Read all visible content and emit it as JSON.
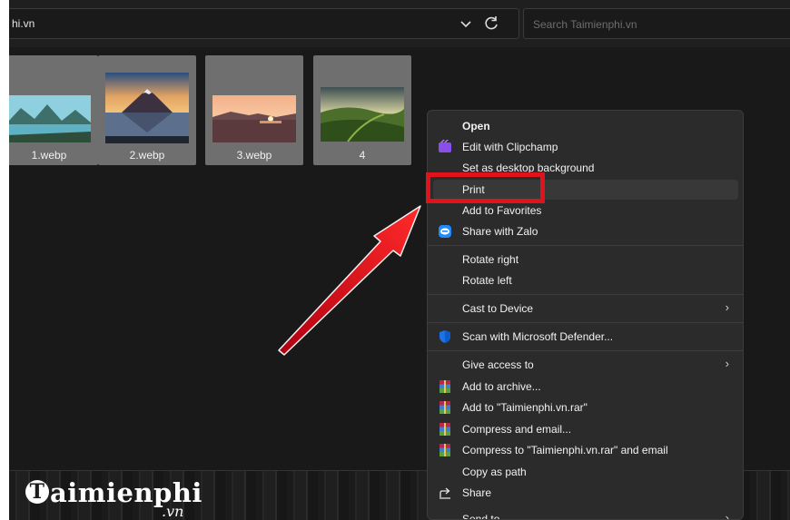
{
  "address_bar": {
    "text": "hi.vn"
  },
  "search": {
    "placeholder": "Search Taimienphi.vn"
  },
  "files": [
    {
      "name": "1.webp",
      "selected": true
    },
    {
      "name": "2.webp",
      "selected": true
    },
    {
      "name": "3.webp",
      "selected": true
    },
    {
      "name": "4",
      "selected": true
    }
  ],
  "context_menu": {
    "items": [
      {
        "label": "Open"
      },
      {
        "label": "Edit with Clipchamp",
        "icon": "clipchamp-icon"
      },
      {
        "label": "Set as desktop background"
      },
      {
        "label": "Print",
        "highlighted": true
      },
      {
        "label": "Add to Favorites"
      },
      {
        "label": "Share with Zalo",
        "icon": "zalo-icon"
      },
      {
        "label": "Rotate right"
      },
      {
        "label": "Rotate left"
      },
      {
        "label": "Cast to Device",
        "submenu": true
      },
      {
        "label": "Scan with Microsoft Defender...",
        "icon": "defender-shield-icon"
      },
      {
        "label": "Give access to",
        "submenu": true
      },
      {
        "label": "Add to archive...",
        "icon": "winrar-icon"
      },
      {
        "label": "Add to \"Taimienphi.vn.rar\"",
        "icon": "winrar-icon"
      },
      {
        "label": "Compress and email...",
        "icon": "winrar-icon"
      },
      {
        "label": "Compress to \"Taimienphi.vn.rar\" and email",
        "icon": "winrar-icon"
      },
      {
        "label": "Copy as path"
      },
      {
        "label": "Share",
        "icon": "share-icon"
      },
      {
        "label": "Send to",
        "submenu": true
      }
    ]
  },
  "watermark": {
    "brand_letter": "T",
    "brand_rest": "aimienphi",
    "suffix": ".vn"
  },
  "colors": {
    "annotation_red": "#e0121b",
    "menu_bg": "#2b2b2b",
    "window_bg": "#191919"
  }
}
